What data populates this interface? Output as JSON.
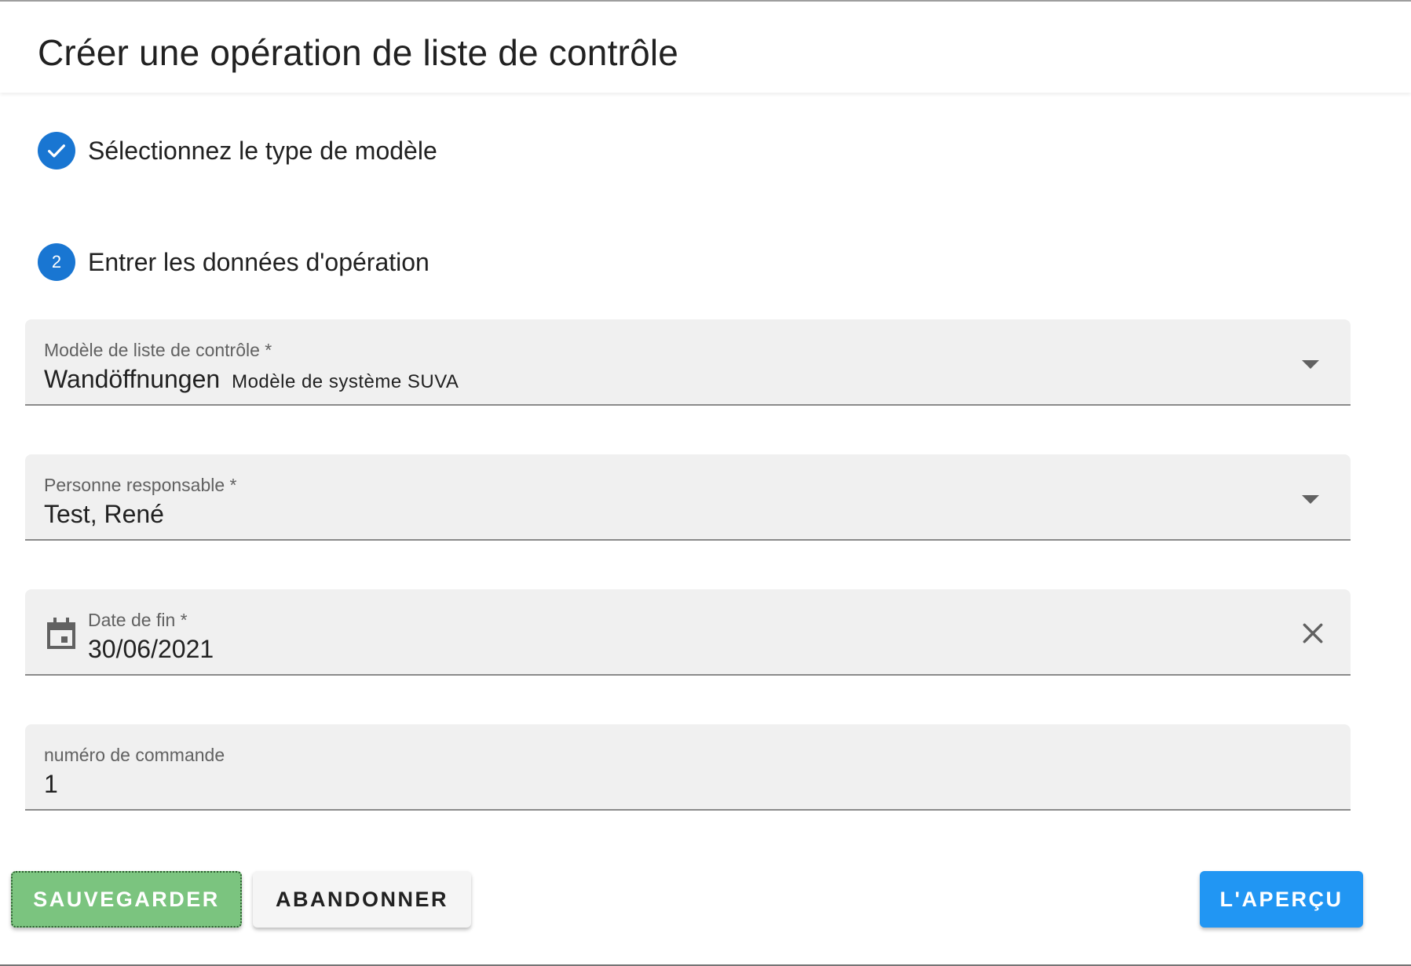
{
  "dialog": {
    "title": "Créer une opération de liste de contrôle"
  },
  "stepper": {
    "steps": [
      {
        "label": "Sélectionnez le type de modèle",
        "state": "completed"
      },
      {
        "number": "2",
        "label": "Entrer les données d'opération",
        "state": "active"
      }
    ]
  },
  "form": {
    "template": {
      "label": "Modèle de liste de contrôle *",
      "value": "Wandöffnungen",
      "subtitle": "Modèle de système SUVA"
    },
    "responsible": {
      "label": "Personne responsable *",
      "value": "Test, René"
    },
    "end_date": {
      "label": "Date de fin *",
      "value": "30/06/2021"
    },
    "order_number": {
      "label": "numéro de commande",
      "value": "1"
    }
  },
  "actions": {
    "save": "SAUVEGARDER",
    "cancel": "ABANDONNER",
    "preview": "L'APERÇU"
  },
  "icons": {
    "step1": "check-icon",
    "dropdown": "chevron-down-icon",
    "date": "calendar-icon",
    "clear": "close-icon"
  },
  "colors": {
    "primary": "#1976d2",
    "save": "#7bc47f",
    "preview": "#2196f3",
    "field_bg": "#f0f0f0"
  }
}
